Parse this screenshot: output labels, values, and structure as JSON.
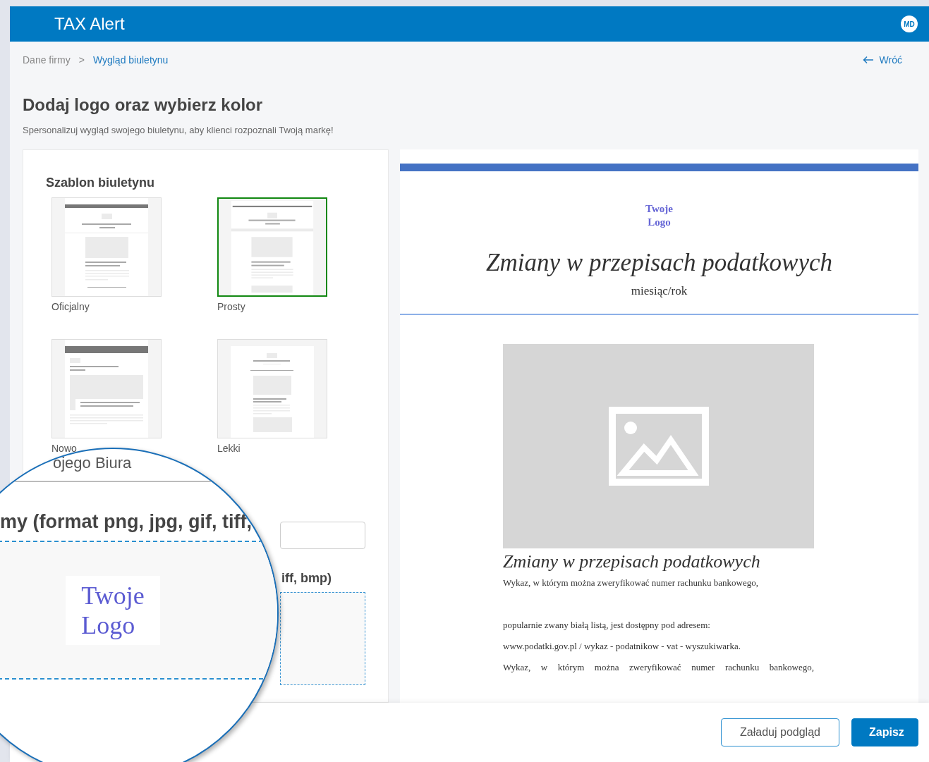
{
  "header": {
    "title": "TAX Alert",
    "avatar": "MD"
  },
  "breadcrumb": {
    "separator": ">",
    "items": [
      {
        "label": "Dane firmy",
        "selected": false
      },
      {
        "label": "Wygląd biuletynu",
        "selected": true
      }
    ]
  },
  "back_link": "Wróć",
  "page_title": "Dodaj logo oraz wybierz kolor",
  "subtitle": "Spersonalizuj wygląd swojego biuletynu, aby klienci rozpoznali Twoją markę!",
  "template_section": {
    "title": "Szablon biuletynu",
    "templates": [
      {
        "label": "Oficjalny",
        "kind": "official",
        "selected": false
      },
      {
        "label": "Prosty",
        "kind": "simple",
        "selected": true
      },
      {
        "label": "Nowo",
        "kind": "modern",
        "selected": false
      },
      {
        "label": "Lekki",
        "kind": "light",
        "selected": false
      }
    ]
  },
  "logo_upload": {
    "label": "iff, bmp)"
  },
  "magnifier": {
    "section_label": "ojego Biura",
    "upload_label": "my (format png, jpg, gif, tiff,",
    "logo": [
      "Twoje",
      "Logo"
    ]
  },
  "preview": {
    "logo": [
      "Twoje",
      "Logo"
    ],
    "title": "Zmiany w przepisach podatkowych",
    "date": "miesiąc/rok",
    "section_title": "Zmiany w przepisach podatkowych",
    "paragraphs": [
      {
        "text": "Wykaz, w którym można zweryfikować numer rachunku bankowego,",
        "kind": "plain"
      },
      {
        "text": "popularnie zwany białą listą, jest dostępny pod adresem:",
        "kind": "plain"
      },
      {
        "text": "www.podatki.gov.pl / wykaz - podatnikow - vat - wyszukiwarka.",
        "kind": "plain"
      },
      {
        "text": "Wykaz, w którym można zweryfikować numer rachunku bankowego,",
        "kind": "justified"
      }
    ]
  },
  "buttons": [
    {
      "label": "Załaduj podgląd",
      "kind": "secondary"
    },
    {
      "label": "Zapisz",
      "kind": "primary"
    }
  ]
}
